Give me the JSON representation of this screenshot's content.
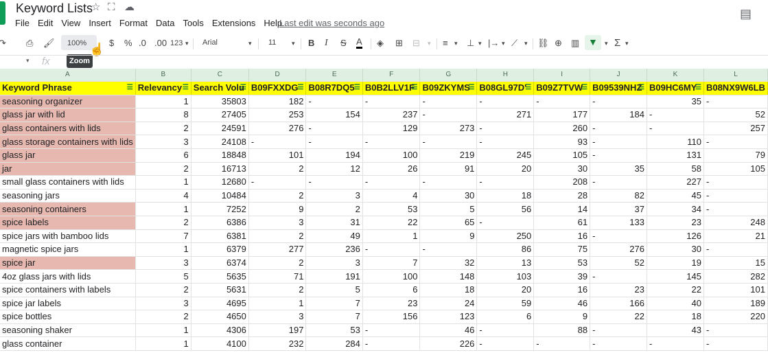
{
  "title": "Keyword Lists",
  "menu": [
    "File",
    "Edit",
    "View",
    "Insert",
    "Format",
    "Data",
    "Tools",
    "Extensions",
    "Help"
  ],
  "last_edit": "Last edit was seconds ago",
  "toolbar": {
    "zoom": "100%",
    "tooltip": "Zoom",
    "currency": "$",
    "percent": "%",
    "dec_less": ".0",
    "dec_more": ".00",
    "number_format": "123",
    "font": "Arial",
    "font_size": "11",
    "bold": "B",
    "italic": "I",
    "strike": "S",
    "text_color": "A",
    "sum": "Σ"
  },
  "formula_bar": {
    "fx": "fx"
  },
  "columns": [
    "A",
    "B",
    "C",
    "D",
    "E",
    "F",
    "G",
    "H",
    "I",
    "J",
    "K",
    "L"
  ],
  "headers": [
    "Keyword Phrase",
    "Relevancy",
    "Search Volu",
    "B09FXXDG",
    "B08R7DQ5",
    "B0B2LLV1F",
    "B09ZKYMS",
    "B08GL97D'",
    "B09Z7TVW",
    "B09539NHZ",
    "B09HC6MY",
    "B08NX9W6LB"
  ],
  "rows": [
    {
      "kw": "seasoning organizer",
      "rel": "1",
      "vol": "35803",
      "v": [
        "182",
        "-",
        "-",
        "-",
        "-",
        "-",
        "-",
        "35",
        "-"
      ],
      "pink": true
    },
    {
      "kw": "glass jar with lid",
      "rel": "8",
      "vol": "27405",
      "v": [
        "253",
        "154",
        "237",
        "-",
        "271",
        "177",
        "184",
        "-",
        "52"
      ],
      "pink": true
    },
    {
      "kw": "glass containers with lids",
      "rel": "2",
      "vol": "24591",
      "v": [
        "276",
        "-",
        "129",
        "273",
        "-",
        "260",
        "-",
        "-",
        "257"
      ],
      "pink": true
    },
    {
      "kw": "glass storage containers with lids",
      "rel": "3",
      "vol": "24108",
      "v": [
        "-",
        "-",
        "-",
        "-",
        "-",
        "93",
        "-",
        "110",
        "-"
      ],
      "pink": true
    },
    {
      "kw": "glass jar",
      "rel": "6",
      "vol": "18848",
      "v": [
        "101",
        "194",
        "100",
        "219",
        "245",
        "105",
        "-",
        "131",
        "79"
      ],
      "pink": true
    },
    {
      "kw": "jar",
      "rel": "2",
      "vol": "16713",
      "v": [
        "2",
        "12",
        "26",
        "91",
        "20",
        "30",
        "35",
        "58",
        "105"
      ],
      "pink": true
    },
    {
      "kw": "small glass containers with lids",
      "rel": "1",
      "vol": "12680",
      "v": [
        "-",
        "-",
        "-",
        "-",
        "-",
        "208",
        "-",
        "227",
        "-"
      ],
      "pink": false
    },
    {
      "kw": "seasoning jars",
      "rel": "4",
      "vol": "10484",
      "v": [
        "2",
        "3",
        "4",
        "30",
        "18",
        "28",
        "82",
        "45",
        "-"
      ],
      "pink": false
    },
    {
      "kw": "seasoning containers",
      "rel": "1",
      "vol": "7252",
      "v": [
        "9",
        "2",
        "53",
        "5",
        "56",
        "14",
        "37",
        "34",
        "-"
      ],
      "pink": true
    },
    {
      "kw": "spice labels",
      "rel": "2",
      "vol": "6386",
      "v": [
        "3",
        "31",
        "22",
        "65",
        "-",
        "61",
        "133",
        "23",
        "248"
      ],
      "pink": true
    },
    {
      "kw": "spice jars with bamboo lids",
      "rel": "7",
      "vol": "6381",
      "v": [
        "2",
        "49",
        "1",
        "9",
        "250",
        "16",
        "-",
        "126",
        "21"
      ],
      "pink": false
    },
    {
      "kw": "magnetic spice jars",
      "rel": "1",
      "vol": "6379",
      "v": [
        "277",
        "236",
        "-",
        "-",
        "86",
        "75",
        "276",
        "30",
        "-"
      ],
      "pink": false
    },
    {
      "kw": "spice jar",
      "rel": "3",
      "vol": "6374",
      "v": [
        "2",
        "3",
        "7",
        "32",
        "13",
        "53",
        "52",
        "19",
        "15"
      ],
      "pink": true
    },
    {
      "kw": "4oz glass jars with lids",
      "rel": "5",
      "vol": "5635",
      "v": [
        "71",
        "191",
        "100",
        "148",
        "103",
        "39",
        "-",
        "145",
        "282"
      ],
      "pink": false
    },
    {
      "kw": "spice containers with labels",
      "rel": "2",
      "vol": "5631",
      "v": [
        "2",
        "5",
        "6",
        "18",
        "20",
        "16",
        "23",
        "22",
        "101"
      ],
      "pink": false
    },
    {
      "kw": "spice jar labels",
      "rel": "3",
      "vol": "4695",
      "v": [
        "1",
        "7",
        "23",
        "24",
        "59",
        "46",
        "166",
        "40",
        "189"
      ],
      "pink": false
    },
    {
      "kw": "spice bottles",
      "rel": "2",
      "vol": "4650",
      "v": [
        "3",
        "7",
        "156",
        "123",
        "6",
        "9",
        "22",
        "18",
        "220"
      ],
      "pink": false
    },
    {
      "kw": "seasoning shaker",
      "rel": "1",
      "vol": "4306",
      "v": [
        "197",
        "53",
        "-",
        "46",
        "-",
        "88",
        "-",
        "43",
        "-"
      ],
      "pink": false
    },
    {
      "kw": "glass container",
      "rel": "1",
      "vol": "4100",
      "v": [
        "232",
        "284",
        "-",
        "226",
        "-",
        "-",
        "-",
        "-",
        "-"
      ],
      "pink": false
    }
  ],
  "colors": {
    "header_yellow": "#ffff00",
    "highlight_pink": "#e6b8af",
    "colhdr_green": "#dff0e3",
    "filter_green": "#188038"
  }
}
